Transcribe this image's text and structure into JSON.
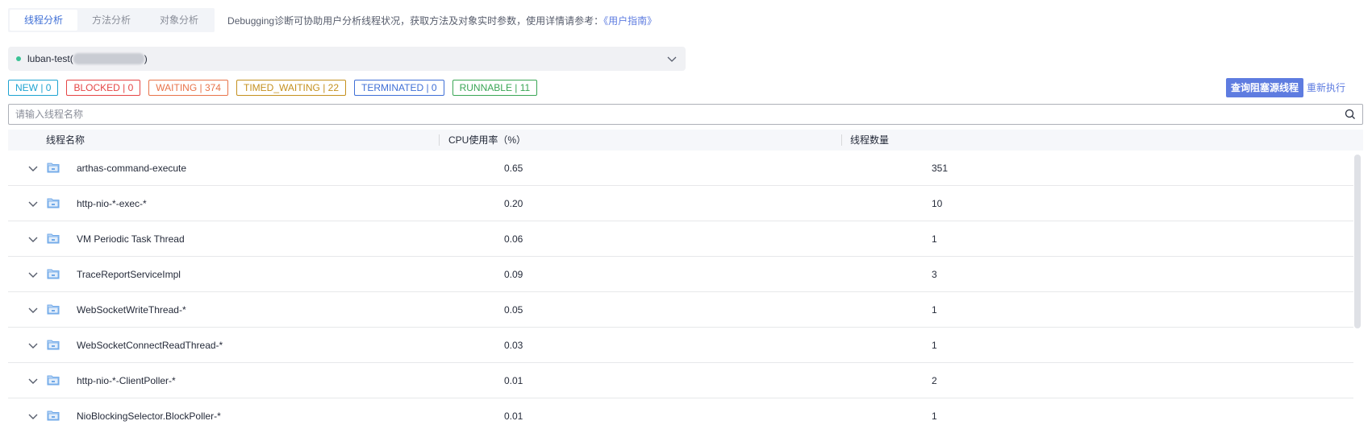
{
  "tabs": [
    {
      "label": "线程分析",
      "active": true
    },
    {
      "label": "方法分析",
      "active": false
    },
    {
      "label": "对象分析",
      "active": false
    }
  ],
  "hint": {
    "text": "Debugging诊断可协助用户分析线程状况，获取方法及对象实时参数，使用详情请参考：",
    "link": "《用户指南》"
  },
  "instance": {
    "name_prefix": "luban-test(",
    "name_suffix": ")",
    "status_color": "#3ac295"
  },
  "status_tags": [
    {
      "label": "NEW | 0",
      "color": "#1ea3d1"
    },
    {
      "label": "BLOCKED | 0",
      "color": "#e54545"
    },
    {
      "label": "WAITING | 374",
      "color": "#e8734a"
    },
    {
      "label": "TIMED_WAITING | 22",
      "color": "#c4901e"
    },
    {
      "label": "TERMINATED | 0",
      "color": "#3f6fd6"
    },
    {
      "label": "RUNNABLE | 11",
      "color": "#3aa655"
    }
  ],
  "actions": {
    "query_blocking": "查询阻塞源线程",
    "rerun": "重新执行"
  },
  "search": {
    "placeholder": "请输入线程名称"
  },
  "table": {
    "columns": [
      "线程名称",
      "CPU使用率（%）",
      "线程数量"
    ],
    "rows": [
      {
        "name": "arthas-command-execute",
        "cpu": "0.65",
        "count": "351"
      },
      {
        "name": "http-nio-*-exec-*",
        "cpu": "0.20",
        "count": "10"
      },
      {
        "name": "VM Periodic Task Thread",
        "cpu": "0.06",
        "count": "1"
      },
      {
        "name": "TraceReportServiceImpl",
        "cpu": "0.09",
        "count": "3"
      },
      {
        "name": "WebSocketWriteThread-*",
        "cpu": "0.05",
        "count": "1"
      },
      {
        "name": "WebSocketConnectReadThread-*",
        "cpu": "0.03",
        "count": "1"
      },
      {
        "name": "http-nio-*-ClientPoller-*",
        "cpu": "0.01",
        "count": "2"
      },
      {
        "name": "NioBlockingSelector.BlockPoller-*",
        "cpu": "0.01",
        "count": "1"
      }
    ]
  },
  "colors": {
    "accent": "#5e7ce0",
    "folder": "#6fa8e8"
  }
}
